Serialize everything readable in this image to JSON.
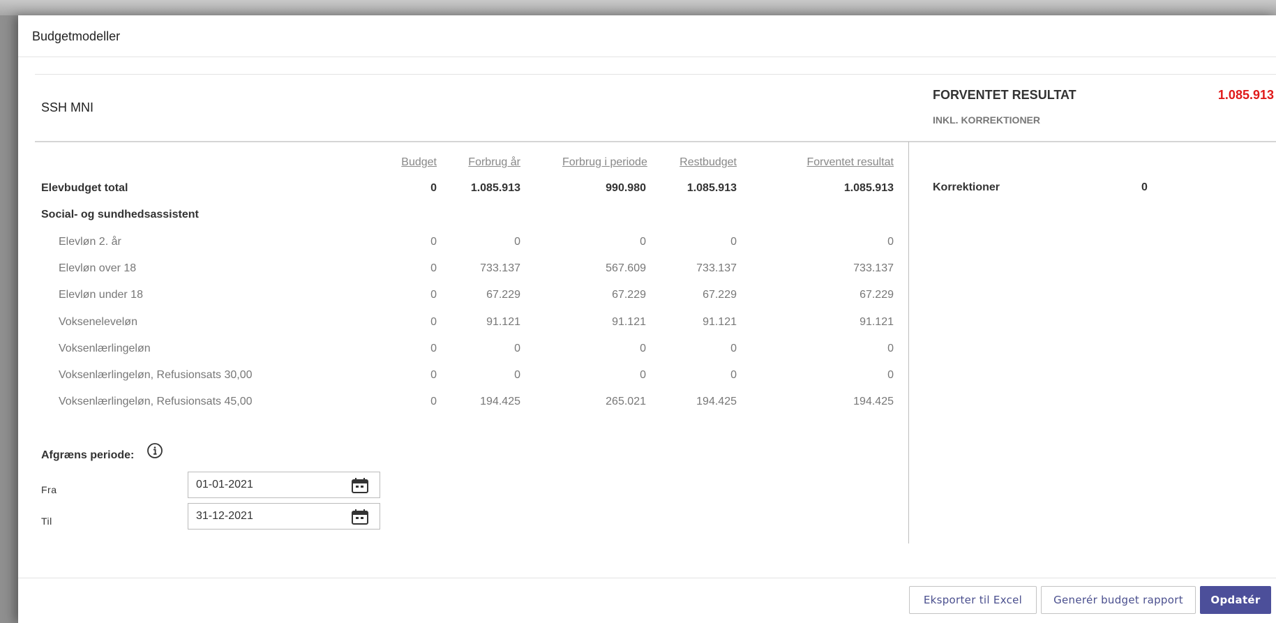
{
  "dialog": {
    "title": "Budgetmodeller"
  },
  "model": {
    "name": "SSH MNI"
  },
  "summary": {
    "result_label": "FORVENTET RESULTAT",
    "result_value": "1.085.913",
    "result_sub": "INKL. KORREKTIONER",
    "corrections_label": "Korrektioner",
    "corrections_value": "0",
    "result_color": "#e01a1a"
  },
  "table": {
    "headers": [
      "Budget",
      "Forbrug år",
      "Forbrug i periode",
      "Restbudget",
      "Forventet resultat"
    ],
    "rows": [
      {
        "label": "Elevbudget total",
        "style": "bold",
        "values": [
          "0",
          "1.085.913",
          "990.980",
          "1.085.913",
          "1.085.913"
        ]
      },
      {
        "label": "Social- og sundhedsassistent",
        "style": "group",
        "values": []
      },
      {
        "label": "Elevløn 2. år",
        "style": "indent",
        "values": [
          "0",
          "0",
          "0",
          "0",
          "0"
        ]
      },
      {
        "label": "Elevløn over 18",
        "style": "indent",
        "values": [
          "0",
          "733.137",
          "567.609",
          "733.137",
          "733.137"
        ]
      },
      {
        "label": "Elevløn under 18",
        "style": "indent",
        "values": [
          "0",
          "67.229",
          "67.229",
          "67.229",
          "67.229"
        ]
      },
      {
        "label": "Vokseneleveløn",
        "style": "indent",
        "values": [
          "0",
          "91.121",
          "91.121",
          "91.121",
          "91.121"
        ]
      },
      {
        "label": "Voksenlærlingeløn",
        "style": "indent",
        "values": [
          "0",
          "0",
          "0",
          "0",
          "0"
        ]
      },
      {
        "label": "Voksenlærlingeløn, Refusionsats 30,00",
        "style": "indent",
        "values": [
          "0",
          "0",
          "0",
          "0",
          "0"
        ]
      },
      {
        "label": "Voksenlærlingeløn, Refusionsats 45,00",
        "style": "indent",
        "values": [
          "0",
          "194.425",
          "265.021",
          "194.425",
          "194.425"
        ]
      }
    ]
  },
  "period": {
    "label": "Afgræns periode:",
    "from_label": "Fra",
    "from_value": "01-01-2021",
    "to_label": "Til",
    "to_value": "31-12-2021"
  },
  "footer": {
    "export_label": "Eksporter til Excel",
    "report_label": "Generér budget rapport",
    "update_label": "Opdatér",
    "accent_color": "#4c4f9a"
  },
  "icons": {
    "info": "info-icon",
    "calendar": "calendar-icon"
  }
}
